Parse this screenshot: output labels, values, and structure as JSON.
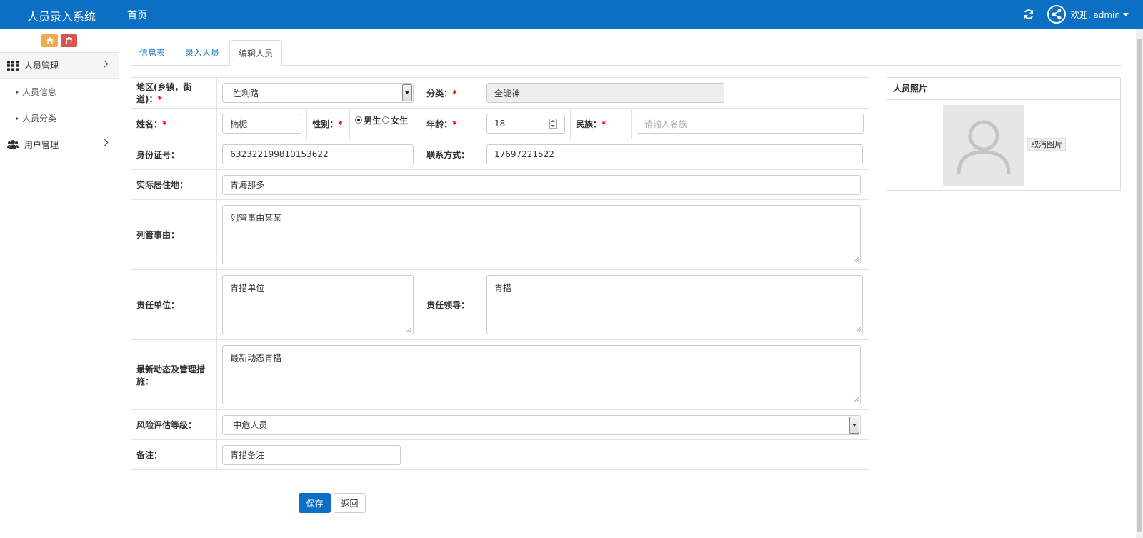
{
  "header": {
    "app_title": "人员录入系统",
    "home_link": "首页",
    "welcome_text": "欢迎, admin"
  },
  "sidebar": {
    "groups": [
      {
        "label": "人员管理",
        "icon": "grid-icon",
        "items": [
          "人员信息",
          "人员分类"
        ]
      },
      {
        "label": "用户管理",
        "icon": "users-icon",
        "items": []
      }
    ]
  },
  "tabs": [
    "信息表",
    "录入人员",
    "编辑人员"
  ],
  "active_tab": "编辑人员",
  "form": {
    "region_label": "地区(乡镇，街道)：",
    "region_value": "胜利路",
    "category_label": "分类：",
    "category_value": "全能神",
    "name_label": "姓名：",
    "name_value": "楠栀",
    "gender_label": "性别：",
    "gender_male": "男生",
    "gender_female": "女生",
    "gender_selected": "男生",
    "age_label": "年龄：",
    "age_value": "18",
    "ethnicity_label": "民族：",
    "ethnicity_placeholder": "请输入名族",
    "id_label": "身份证号：",
    "id_value": "632322199810153622",
    "contact_label": "联系方式：",
    "contact_value": "17697221522",
    "address_label": "实际居住地：",
    "address_value": "青海那多",
    "reason_label": "列管事由：",
    "reason_value": "列管事由某某",
    "unit_label": "责任单位：",
    "unit_value": "青措单位",
    "leader_label": "责任领导：",
    "leader_value": "青措",
    "updates_label": "最新动态及管理措施：",
    "updates_value": "最新动态青措",
    "risk_label": "风险评估等级：",
    "risk_value": "中危人员",
    "remark_label": "备注：",
    "remark_value": "青措备注",
    "required_mark": "*"
  },
  "photo": {
    "title": "人员照片",
    "cancel_label": "取消图片"
  },
  "actions": {
    "save_label": "保存",
    "back_label": "返回"
  },
  "colors": {
    "primary": "#0b70c4",
    "home_button": "#f0ad4e",
    "delete_button": "#d9534f",
    "required": "#ee0000"
  }
}
